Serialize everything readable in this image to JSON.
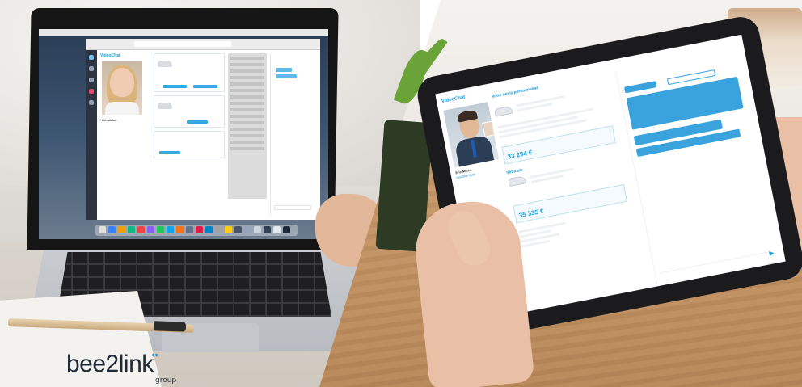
{
  "brand": {
    "name": "bee2link",
    "tagline": "group",
    "accent_color": "#1c9ad6"
  },
  "laptop_screen": {
    "app_name": "VideoChat",
    "agent_name": "Géraldine",
    "agent_email": "...",
    "chat_input_placeholder": ""
  },
  "tablet_screen": {
    "app_name": "VideoChat",
    "agent_name": "Eric Mart...",
    "agent_company": "bee2link Auto",
    "section_vehicle": "Véhicule",
    "section_quote": "Votre devis personnalisé",
    "price_1": "33 294 €",
    "price_2": "35 335 €"
  }
}
